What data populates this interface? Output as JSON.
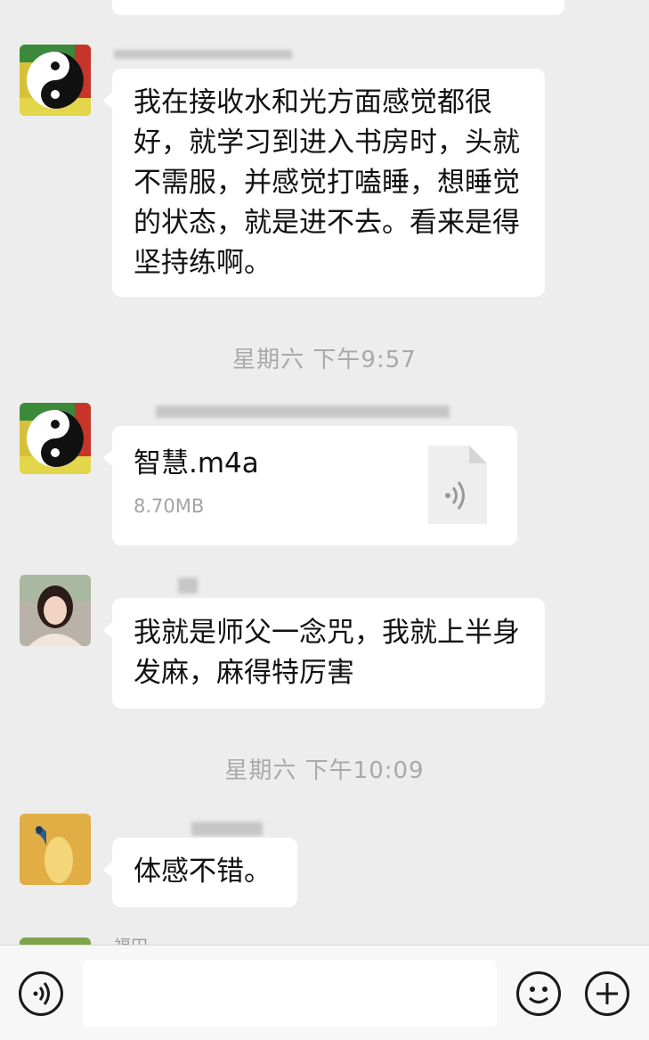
{
  "messages": [
    {
      "text": "我在接收水和光方面感觉都很好，就学习到进入书房时，头就不需服，并感觉打嗑睡，想睡觉的状态，就是进不去。看来是得坚持练啊。"
    },
    {
      "time": "星期六 下午9:57"
    },
    {
      "file": {
        "name": "智慧.m4a",
        "size": "8.70MB"
      }
    },
    {
      "text": "我就是师父一念咒，我就上半身发麻，麻得特厉害"
    },
    {
      "time": "星期六 下午10:09"
    },
    {
      "text": "体感不错。"
    },
    {
      "sender_partial": "福田"
    }
  ],
  "icons": {
    "voice": "voice-toggle-icon",
    "emoji": "emoji-icon",
    "plus": "plus-icon",
    "audio_file": "audio-file-icon"
  },
  "colors": {
    "background": "#ededed",
    "bubble": "#ffffff",
    "timestamp": "#a9a9a9"
  }
}
